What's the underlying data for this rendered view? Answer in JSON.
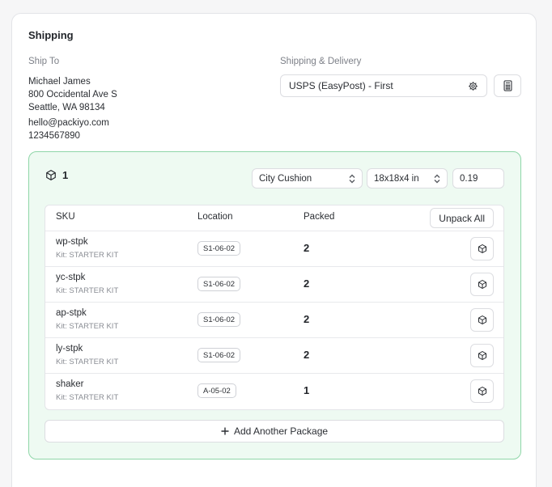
{
  "shipping": {
    "title": "Shipping",
    "ship_to_label": "Ship To",
    "delivery_label": "Shipping & Delivery",
    "address": {
      "name": "Michael James",
      "street": "800 Occidental Ave S",
      "city_line": "Seattle, WA 98134",
      "email": "hello@packiyo.com",
      "phone": "1234567890"
    },
    "carrier_value": "USPS (EasyPost) - First",
    "icons": {
      "carrier_settings": "gear-icon",
      "rates": "calculator-icon"
    }
  },
  "package": {
    "number": "1",
    "box_select": "City Cushion",
    "dimensions_select": "18x18x4 in",
    "weight_value": "0.19",
    "table": {
      "headers": {
        "sku": "SKU",
        "location": "Location",
        "packed": "Packed"
      },
      "unpack_all_label": "Unpack All",
      "rows": [
        {
          "sku": "wp-stpk",
          "kit": "Kit: STARTER KIT",
          "location": "S1-06-02",
          "packed": "2"
        },
        {
          "sku": "yc-stpk",
          "kit": "Kit: STARTER KIT",
          "location": "S1-06-02",
          "packed": "2"
        },
        {
          "sku": "ap-stpk",
          "kit": "Kit: STARTER KIT",
          "location": "S1-06-02",
          "packed": "2"
        },
        {
          "sku": "ly-stpk",
          "kit": "Kit: STARTER KIT",
          "location": "S1-06-02",
          "packed": "2"
        },
        {
          "sku": "shaker",
          "kit": "Kit: STARTER KIT",
          "location": "A-05-02",
          "packed": "1"
        }
      ]
    },
    "add_package_label": "Add Another Package"
  },
  "colors": {
    "package_border": "#8fd6a8",
    "package_background": "#eefaf2"
  }
}
